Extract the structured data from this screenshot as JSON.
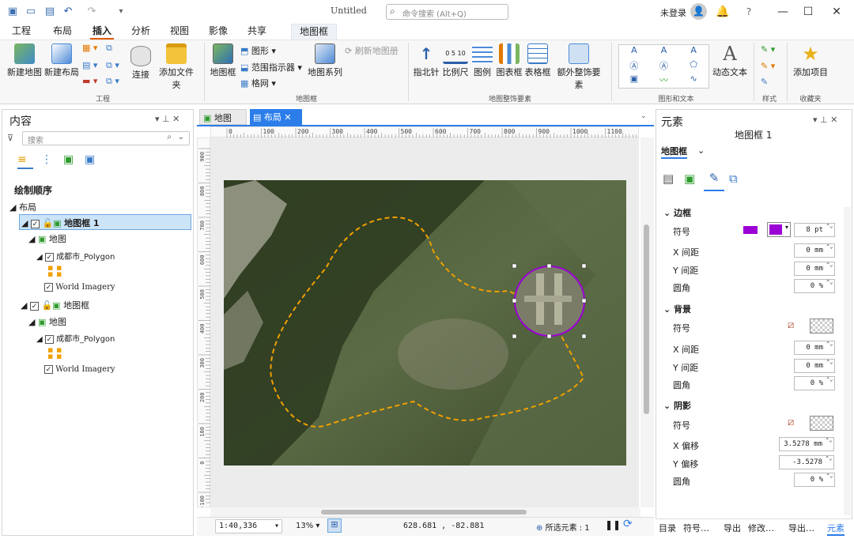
{
  "window": {
    "title": "Untitled",
    "search_placeholder": "命令搜索 (Alt+Q)",
    "user": "未登录",
    "help": "?",
    "minimize": "—",
    "maximize": "☐",
    "close": "✕"
  },
  "tabs": [
    "工程",
    "布局",
    "插入",
    "分析",
    "视图",
    "影像",
    "共享",
    "地图框"
  ],
  "active_tab": "插入",
  "ribbon": {
    "groups": {
      "project": "工程",
      "mapframe": "地图框",
      "map_surround": "地图整饰要素",
      "graphics_text": "图形和文本",
      "styles": "样式",
      "favorites": "收藏夹"
    },
    "buttons": {
      "new_map": "新建地图",
      "new_layout": "新建布局",
      "connect": "连接",
      "add_folder": "添加文件夹",
      "map_frame": "地图框",
      "graphic": "图形",
      "extent_indicator": "范围指示器",
      "grid": "格网",
      "map_series": "地图系列",
      "refresh_atlas": "刷新地图册",
      "north_arrow": "指北针",
      "scale_bar": "比例尺",
      "legend": "图例",
      "chart_frame": "图表框",
      "table_frame": "表格框",
      "extra_surround": "额外整饰要素",
      "dynamic_text": "动态文本",
      "add_item": "添加项目"
    },
    "scale_bar_ticks": "0 5 10"
  },
  "contents": {
    "title": "内容",
    "search_placeholder": "搜索",
    "drawing_order": "绘制顺序",
    "layout": "布局",
    "items": [
      {
        "label": "地图框 1",
        "level": 1,
        "checked": true,
        "selected": true
      },
      {
        "label": "地图",
        "level": 2
      },
      {
        "label": "成都市_Polygon",
        "level": 3,
        "checked": true
      },
      {
        "label": "World Imagery",
        "level": 3,
        "checked": true
      },
      {
        "label": "地图框",
        "level": 1,
        "checked": true
      },
      {
        "label": "地图",
        "level": 2
      },
      {
        "label": "成都市_Polygon",
        "level": 3,
        "checked": true
      },
      {
        "label": "World Imagery",
        "level": 3,
        "checked": true
      }
    ]
  },
  "view_tabs": [
    {
      "label": "地图",
      "active": false
    },
    {
      "label": "布局",
      "active": true
    }
  ],
  "ruler_h": [
    "0",
    "100",
    "200",
    "300",
    "400",
    "500",
    "600",
    "700",
    "800",
    "900",
    "1000",
    "1100"
  ],
  "ruler_v": [
    "900",
    "800",
    "700",
    "600",
    "500",
    "400",
    "300",
    "200",
    "100",
    "0",
    "-100"
  ],
  "status": {
    "scale": "1:40,336",
    "zoom": "13%",
    "coords": "628.681 , -82.881",
    "selected": "所选元素 : 1"
  },
  "element_pane": {
    "title": "元素",
    "subtitle": "地图框 1",
    "dropdown": "地图框",
    "border": {
      "title": "边框",
      "symbol_label": "符号",
      "symbol_color": "#9b00d4",
      "width": "8 pt",
      "x_gap_label": "X 间距",
      "x_gap": "0 mm",
      "y_gap_label": "Y 间距",
      "y_gap": "0 mm",
      "radius_label": "圆角",
      "radius": "0 %"
    },
    "background": {
      "title": "背景",
      "symbol_label": "符号",
      "x_gap_label": "X 间距",
      "x_gap": "0 mm",
      "y_gap_label": "Y 间距",
      "y_gap": "0 mm",
      "radius_label": "圆角",
      "radius": "0 %"
    },
    "shadow": {
      "title": "阴影",
      "symbol_label": "符号",
      "x_off_label": "X 偏移",
      "x_off": "3.5278 mm",
      "y_off_label": "Y 偏移",
      "y_off": "-3.5278 mm",
      "radius_label": "圆角",
      "radius": "0 %"
    },
    "bottom_tabs": [
      "目录",
      "符号…",
      "导出",
      "修改…",
      "导出…",
      "元素"
    ]
  }
}
